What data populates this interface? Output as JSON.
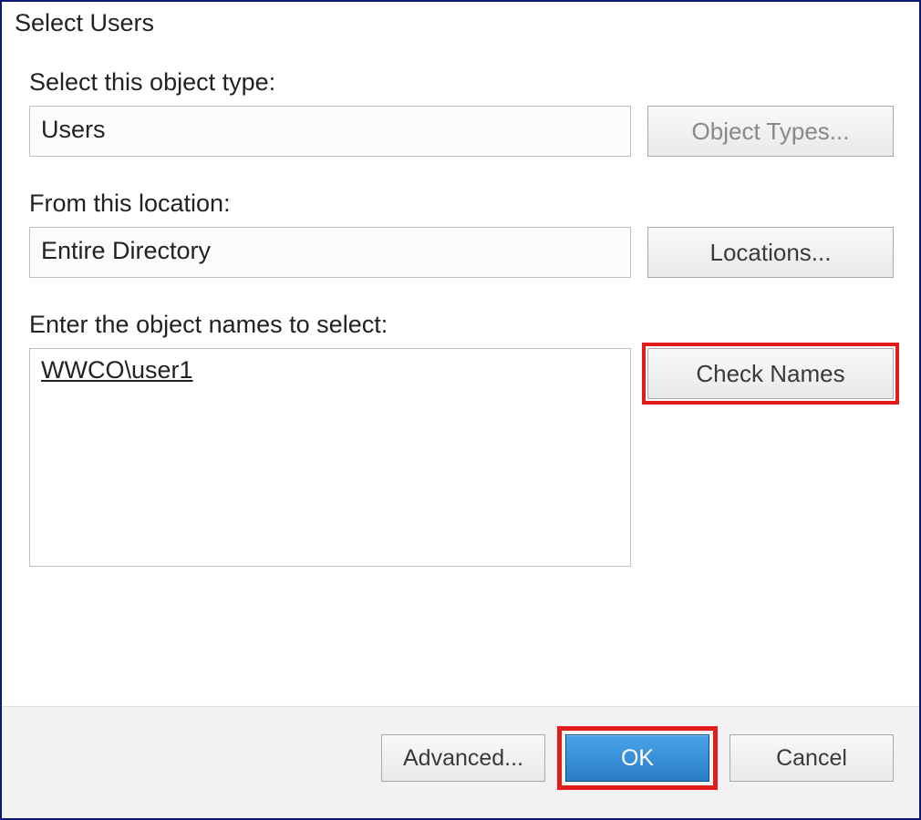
{
  "dialog": {
    "title": "Select Users",
    "object_type": {
      "label": "Select this object type:",
      "value": "Users",
      "button": "Object Types..."
    },
    "location": {
      "label": "From this location:",
      "value": "Entire Directory",
      "button": "Locations..."
    },
    "names": {
      "label": "Enter the object names to select:",
      "value": "WWCO\\user1",
      "button": "Check Names"
    },
    "footer": {
      "advanced": "Advanced...",
      "ok": "OK",
      "cancel": "Cancel"
    }
  }
}
